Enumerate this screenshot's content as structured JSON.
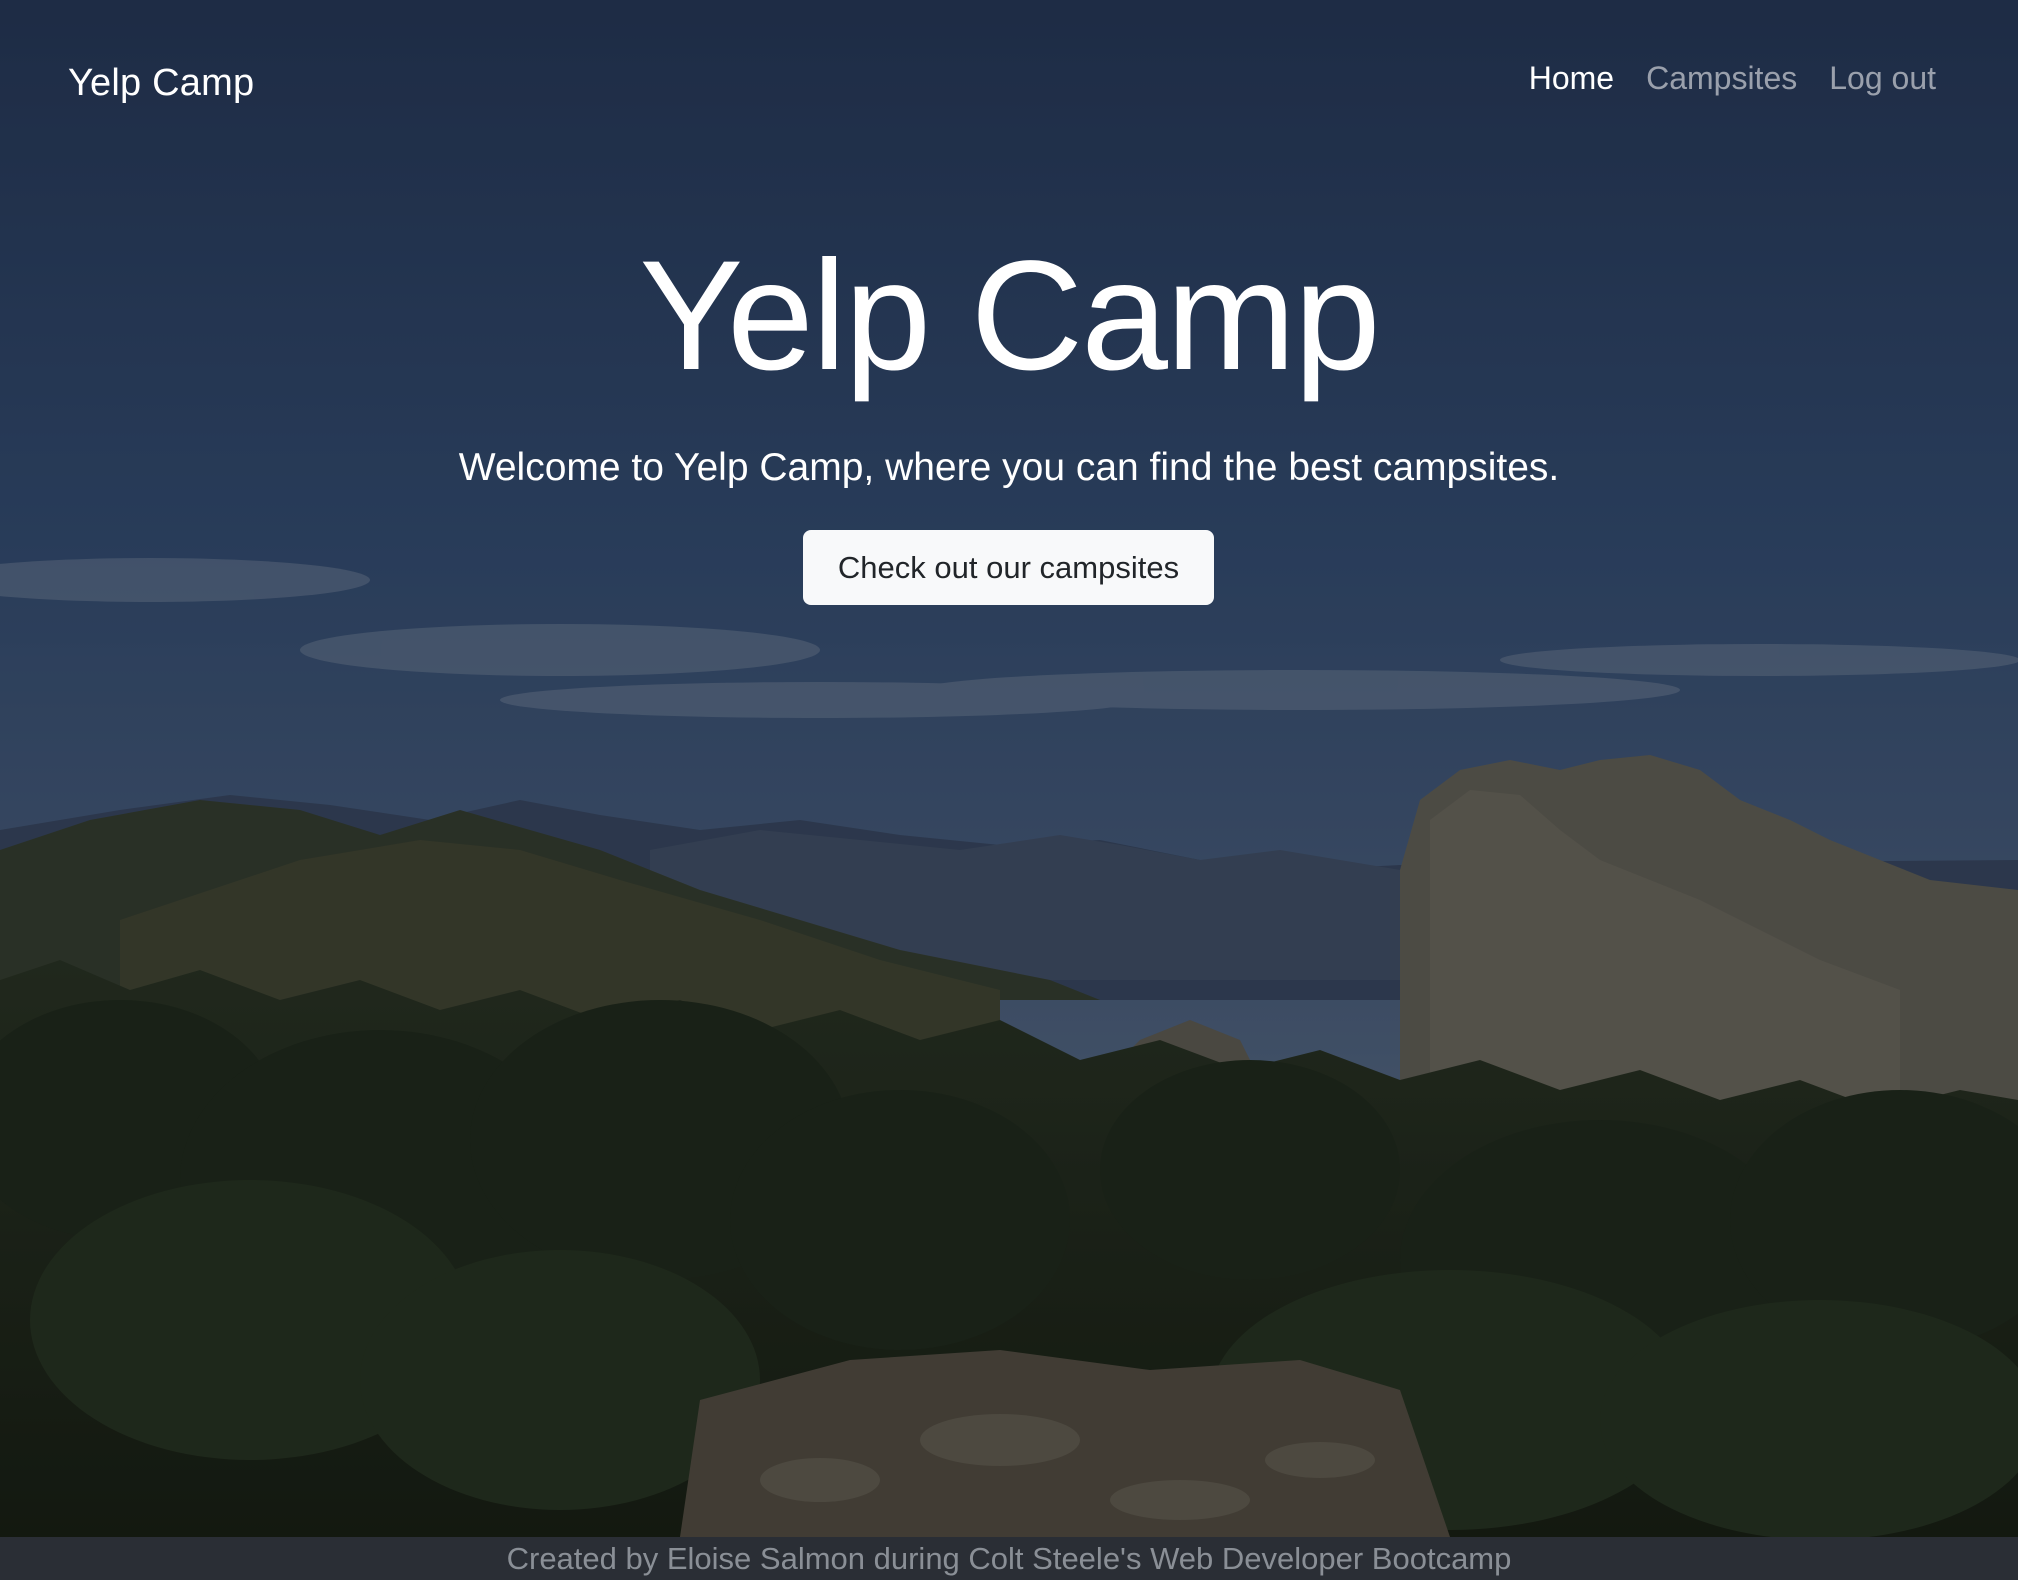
{
  "navbar": {
    "brand": "Yelp Camp",
    "links": [
      {
        "label": "Home",
        "active": true
      },
      {
        "label": "Campsites",
        "active": false
      },
      {
        "label": "Log out",
        "active": false
      }
    ]
  },
  "hero": {
    "title": "Yelp Camp",
    "lead": "Welcome to Yelp Camp, where you can find the best campsites.",
    "button_label": "Check out our campsites"
  },
  "footer": {
    "text": "Created by Eloise Salmon during Colt Steele's Web Developer Bootcamp"
  },
  "colors": {
    "sky_top": "#2c4266",
    "sky_horizon": "#5a6e8c",
    "footer_bg": "#2a2e35",
    "footer_text": "#8a8f96",
    "button_bg": "#f8f9fa"
  }
}
